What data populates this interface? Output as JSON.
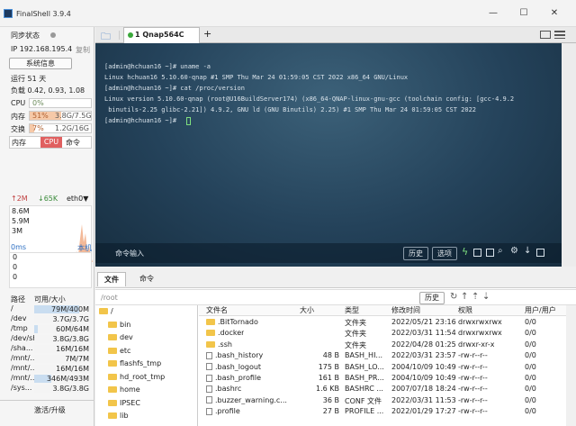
{
  "app": {
    "title": "FinalShell 3.9.4",
    "min": "—",
    "max": "☐",
    "close": "✕"
  },
  "sidebar": {
    "sync_label": "同步状态",
    "ip": "IP 192.168.195.4",
    "copy": "复制",
    "sysinfo_button": "系统信息",
    "uptime": "运行 51 天",
    "load": "负载 0.42, 0.93, 1.08",
    "cpu_label": "CPU",
    "cpu_value": "0%",
    "cpu_fraction": 0.0,
    "mem_label": "内存",
    "mem_pct": "51%",
    "mem_usage": "3.8G/7.5G",
    "mem_fraction": 0.51,
    "swap_label": "交换",
    "swap_pct": "7%",
    "swap_usage": "1.2G/16G",
    "swap_fraction": 0.07,
    "proc_tabs": [
      "内存",
      "CPU",
      "命令"
    ],
    "net": {
      "up": "↑2M",
      "down": "↓65K",
      "iface": "eth0▼",
      "y_labels": [
        "8.6M",
        "5.9M",
        "3M"
      ]
    },
    "latency": {
      "label": "0ms",
      "host": "本机",
      "y_labels": [
        "0",
        "0",
        "0"
      ]
    },
    "disk": {
      "headers": [
        "路径",
        "可用/大小"
      ],
      "rows": [
        {
          "path": "/",
          "size": "79M/400M",
          "fraction": 0.8
        },
        {
          "path": "/dev",
          "size": "3.7G/3.7G",
          "fraction": 0.0
        },
        {
          "path": "/tmp",
          "size": "60M/64M",
          "fraction": 0.06
        },
        {
          "path": "/dev/shm",
          "size": "3.8G/3.8G",
          "fraction": 0.0
        },
        {
          "path": "/sha...",
          "size": "16M/16M",
          "fraction": 0.0
        },
        {
          "path": "/mnt/...",
          "size": "7M/7M",
          "fraction": 0.0
        },
        {
          "path": "/mnt/...",
          "size": "16M/16M",
          "fraction": 0.0
        },
        {
          "path": "/mnt/...",
          "size": "346M/493M",
          "fraction": 0.3
        },
        {
          "path": "/sys...",
          "size": "3.8G/3.8G",
          "fraction": 0.0
        }
      ]
    },
    "activate": "激活/升级"
  },
  "tabs": {
    "active": "1 Qnap564C",
    "add": "+"
  },
  "terminal": {
    "lines": [
      "[admin@hchuan16 ~]# uname -a",
      "Linux hchuan16 5.10.60-qnap #1 SMP Thu Mar 24 01:59:05 CST 2022 x86_64 GNU/Linux",
      "[admin@hchuan16 ~]# cat /proc/version",
      "Linux version 5.10.60-qnap (root@U16BuildServer174) (x86_64-QNAP-linux-gnu-gcc (toolchain config: [gcc-4.9.2",
      " binutils-2.25 glibc-2.21]) 4.9.2, GNU ld (GNU Binutils) 2.25) #1 SMP Thu Mar 24 01:59:05 CST 2022",
      "[admin@hchuan16 ~]# "
    ],
    "cmd_input": "命令输入",
    "history": "历史",
    "options": "选项"
  },
  "files": {
    "tabs": [
      "文件",
      "命令"
    ],
    "path": "/root",
    "history": "历史",
    "tree": [
      "/",
      "bin",
      "dev",
      "etc",
      "flashfs_tmp",
      "hd_root_tmp",
      "home",
      "IPSEC",
      "lib"
    ],
    "headers": [
      "文件名",
      "大小",
      "类型",
      "修改时间",
      "权限",
      "用户/用户"
    ],
    "rows": [
      {
        "name": ".BitTornado",
        "size": "",
        "type": "文件夹",
        "mtime": "2022/05/21 23:16",
        "perm": "drwxrwxrwx",
        "owner": "0/0",
        "folder": true
      },
      {
        "name": ".docker",
        "size": "",
        "type": "文件夹",
        "mtime": "2022/03/31 11:54",
        "perm": "drwxrwxrwx",
        "owner": "0/0",
        "folder": true
      },
      {
        "name": ".ssh",
        "size": "",
        "type": "文件夹",
        "mtime": "2022/04/28 01:25",
        "perm": "drwxr-xr-x",
        "owner": "0/0",
        "folder": true
      },
      {
        "name": ".bash_history",
        "size": "48 B",
        "type": "BASH_HI...",
        "mtime": "2022/03/31 23:57",
        "perm": "-rw-r--r--",
        "owner": "0/0",
        "folder": false
      },
      {
        "name": ".bash_logout",
        "size": "175 B",
        "type": "BASH_LO...",
        "mtime": "2004/10/09 10:49",
        "perm": "-rw-r--r--",
        "owner": "0/0",
        "folder": false
      },
      {
        "name": ".bash_profile",
        "size": "161 B",
        "type": "BASH_PR...",
        "mtime": "2004/10/09 10:49",
        "perm": "-rw-r--r--",
        "owner": "0/0",
        "folder": false
      },
      {
        "name": ".bashrc",
        "size": "1.6 KB",
        "type": "BASHRC ...",
        "mtime": "2007/07/18 18:24",
        "perm": "-rw-r--r--",
        "owner": "0/0",
        "folder": false
      },
      {
        "name": ".buzzer_warning.c...",
        "size": "36 B",
        "type": "CONF 文件",
        "mtime": "2022/03/31 11:53",
        "perm": "-rw-r--r--",
        "owner": "0/0",
        "folder": false
      },
      {
        "name": ".profile",
        "size": "27 B",
        "type": "PROFILE ...",
        "mtime": "2022/01/29 17:27",
        "perm": "-rw-r--r--",
        "owner": "0/0",
        "folder": false
      }
    ]
  },
  "colors": {
    "mem_fill": "#f6c9a8",
    "swap_fill": "#f6c9a8",
    "cpu_fill": "#cfe3c3",
    "accent": "#2d6fc2",
    "proc_active": "#e06060",
    "terminal_bg": "#24425a"
  }
}
